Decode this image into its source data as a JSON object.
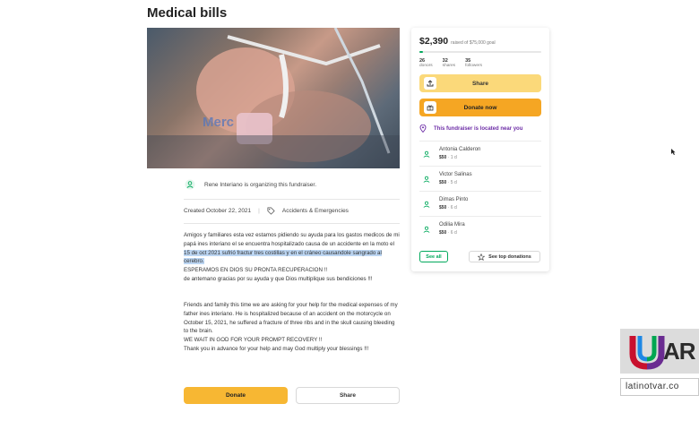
{
  "page": {
    "title": "Medical bills"
  },
  "organizer": {
    "text": "Rene Interiano is organizing this fundraiser."
  },
  "meta": {
    "created": "Created October 22, 2021",
    "category": "Accidents & Emergencies"
  },
  "story": {
    "spanish_lines": [
      "Amigos y familiares esta vez estamos pidiendo su ayuda para los gastos medicos de mi",
      "papá ines interiano el se encuentra hospitalizado causa de un accidente en la moto el"
    ],
    "spanish_highlight": [
      "15 de oct 2021  sufrió fractur  tres costillas y en el cráneo causandole sangrado al",
      "cerebro."
    ],
    "spanish_after": [
      "ESPERAMOS EN DIOS SU PRONTA RECUPERACION !!",
      "de antemano gracias por su ayuda y que Dios multiplique sus bendiciones !!!"
    ],
    "english_lines": [
      "Friends and family this time we are asking for your help for the medical expenses of my",
      "father ines interiano. He is hospitalized because of an accident on the motorcycle on",
      "October 15, 2021, he suffered a fracture of three ribs and in the skull causing bleeding",
      "to the brain.",
      "WE WAIT IN GOD FOR YOUR PROMPT RECOVERY !!",
      "Thank you in advance for your help and may God multiply your blessings !!!"
    ]
  },
  "bottom_buttons": {
    "donate": "Donate",
    "share": "Share"
  },
  "sidebar": {
    "amount": "$2,390",
    "goal": "raised of $75,000 goal",
    "progress_fraction": 0.032,
    "stats": [
      {
        "num": "26",
        "label": "donors"
      },
      {
        "num": "32",
        "label": "shares"
      },
      {
        "num": "35",
        "label": "followers"
      }
    ],
    "share_label": "Share",
    "donate_label": "Donate now",
    "located": "This fundraiser is located near you",
    "donors": [
      {
        "name": "Antonia Calderon",
        "amount": "$50",
        "time": "1 d"
      },
      {
        "name": "Victor Salinas",
        "amount": "$50",
        "time": "5 d"
      },
      {
        "name": "Dimas Pinto",
        "amount": "$50",
        "time": "6 d"
      },
      {
        "name": "Odilia Mira",
        "amount": "$50",
        "time": "6 d"
      }
    ],
    "see_all": "See all",
    "top_donations": "See top donations"
  },
  "watermark": {
    "brand": "AR",
    "url": "latinotvar.co"
  },
  "colors": {
    "accent_green": "#02a95c",
    "donate_orange": "#f5a623",
    "share_yellow": "#fbd97a",
    "purple": "#6c2ca6"
  }
}
